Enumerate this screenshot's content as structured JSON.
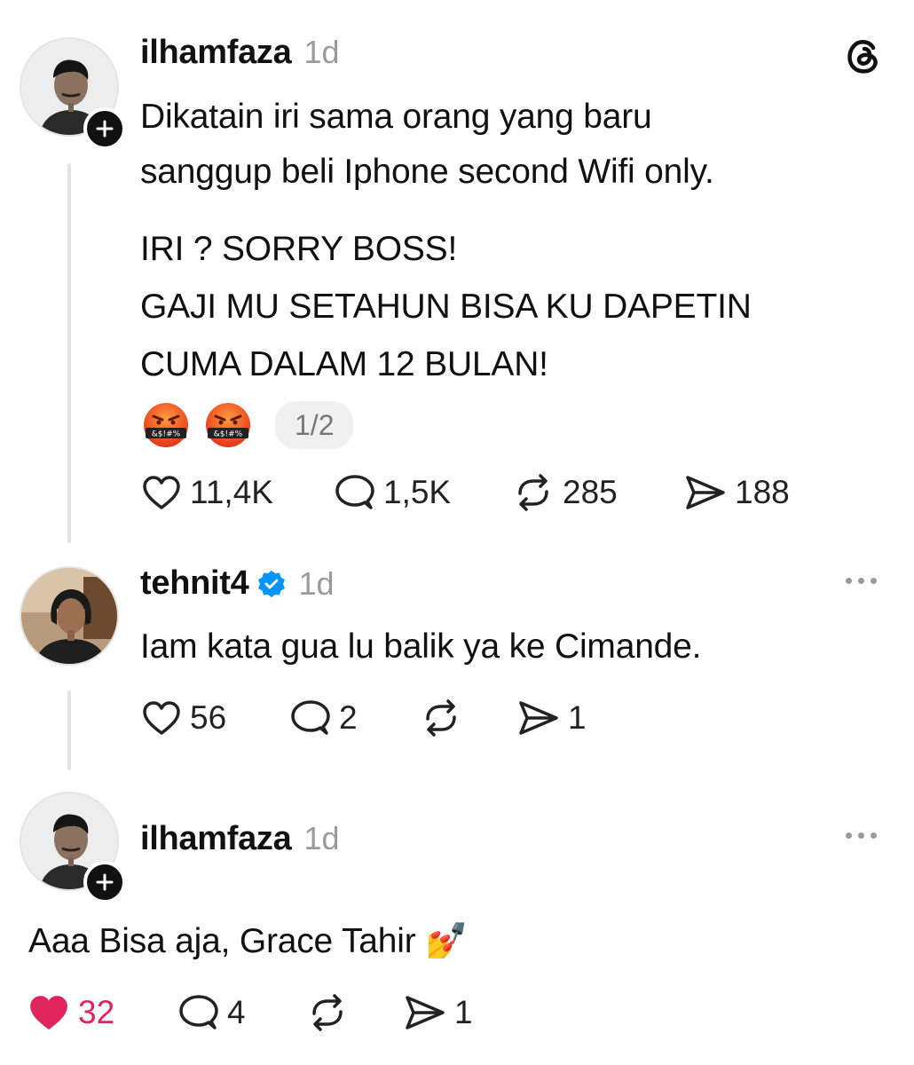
{
  "posts": [
    {
      "username": "ilhamfaza",
      "time": "1d",
      "text_lines": [
        "Dikatain iri sama orang yang baru",
        "sanggup beli Iphone second Wifi only."
      ],
      "text_lines_2": [
        "IRI ? SORRY BOSS!",
        "GAJI MU SETAHUN BISA KU DAPETIN",
        "CUMA DALAM 12 BULAN!"
      ],
      "media_counter": "1/2",
      "emoji_caption": "&$!#%",
      "likes": "11,4K",
      "replies": "1,5K",
      "reposts": "285",
      "shares": "188"
    },
    {
      "username": "tehnit4",
      "time": "1d",
      "text": "Iam kata gua lu balik ya ke Cimande.",
      "likes": "56",
      "replies": "2",
      "shares": "1"
    },
    {
      "username": "ilhamfaza",
      "time": "1d",
      "text": "Aaa Bisa aja, Grace Tahir 💅",
      "likes": "32",
      "replies": "4",
      "shares": "1"
    }
  ],
  "colors": {
    "liked": "#e0245e",
    "verified": "#0095f6",
    "muted": "#9a9a9a",
    "thread_line": "#e3e3e3"
  },
  "icons": [
    "threads-logo-icon",
    "heart-icon",
    "comment-icon",
    "repost-icon",
    "share-icon",
    "more-icon",
    "verified-icon",
    "follow-plus-icon"
  ]
}
